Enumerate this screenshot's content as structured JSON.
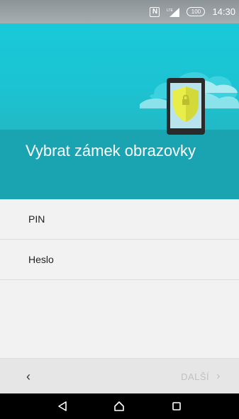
{
  "status_bar": {
    "nfc_icon": "N",
    "signal_label": "LTE",
    "battery_level": "100",
    "time": "14:30"
  },
  "header": {
    "title": "Vybrat zámek obrazovky"
  },
  "options": [
    {
      "label": "PIN"
    },
    {
      "label": "Heslo"
    }
  ],
  "action_bar": {
    "back_glyph": "‹",
    "next_label": "DALŠÍ",
    "next_glyph": "›"
  },
  "colors": {
    "header_top": "#19c9d8",
    "header_bottom": "#1aa4b2",
    "shield": "#e8ed4a",
    "next_disabled": "#c0c0c0"
  },
  "icons": [
    "nfc-icon",
    "signal-icon",
    "battery-icon",
    "cloud-illustration",
    "tablet-shield-illustration",
    "back-nav-icon",
    "home-nav-icon",
    "recents-nav-icon"
  ]
}
